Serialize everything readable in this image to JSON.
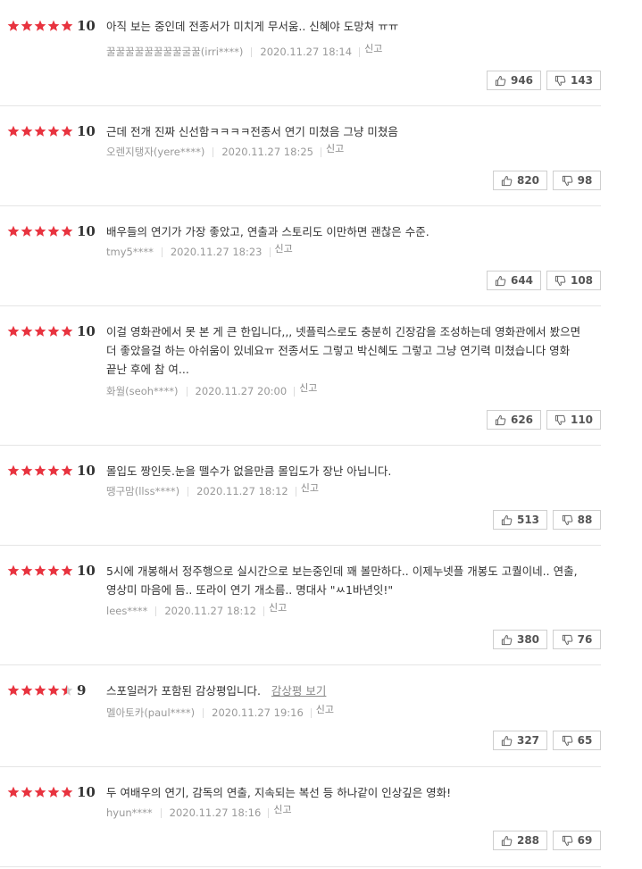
{
  "colors": {
    "star_fill": "#e8333f",
    "star_empty": "#cccccc"
  },
  "actions": {
    "report": "신고"
  },
  "reviews": [
    {
      "stars": 5,
      "half": false,
      "score": "10",
      "text": "아직 보는 중인데 전종서가 미치게 무서움.. 신혜야 도망쳐 ㅠㅠ",
      "user": "꿀꿀꿀꿀꿀꿀꿀꿀굴꿀(irri****)",
      "date": "2020.11.27 18:14",
      "likes": "946",
      "dislikes": "143"
    },
    {
      "stars": 5,
      "half": false,
      "score": "10",
      "text": "근데 전개 진짜 신선함ㅋㅋㅋㅋ전종서 연기 미쳤음 그냥 미쳤음",
      "user": "오렌지탱자(yere****)",
      "date": "2020.11.27 18:25",
      "likes": "820",
      "dislikes": "98"
    },
    {
      "stars": 5,
      "half": false,
      "score": "10",
      "text": "배우들의 연기가 가장 좋았고, 연출과 스토리도 이만하면 괜찮은 수준.",
      "user": "tmy5****",
      "date": "2020.11.27 18:23",
      "likes": "644",
      "dislikes": "108"
    },
    {
      "stars": 5,
      "half": false,
      "score": "10",
      "text": "이걸 영화관에서 못 본 게 큰 한입니다,,, 넷플릭스로도 충분히 긴장감을 조성하는데 영화관에서 봤으면 더 좋았을걸 하는 아쉬움이 있네요ㅠ 전종서도 그렇고 박신혜도 그렇고 그냥 연기력 미쳤습니다 영화 끝난 후에 참 여...",
      "user": "화월(seoh****)",
      "date": "2020.11.27 20:00",
      "likes": "626",
      "dislikes": "110"
    },
    {
      "stars": 5,
      "half": false,
      "score": "10",
      "text": "몰입도 짱인듯.눈을 뗄수가 없을만큼 몰입도가 장난 아닙니다.",
      "user": "땡구맘(llss****)",
      "date": "2020.11.27 18:12",
      "likes": "513",
      "dislikes": "88"
    },
    {
      "stars": 5,
      "half": false,
      "score": "10",
      "text": "5시에 개봉해서 정주행으로 실시간으로 보는중인데 꽤 볼만하다.. 이제누넷플 개봉도 고퀄이네.. 연출, 영상미 마음에 듬.. 또라이 연기 개소름.. 명대사 \"ㅆ1바년잇!\"",
      "user": "lees****",
      "date": "2020.11.27 18:12",
      "likes": "380",
      "dislikes": "76"
    },
    {
      "stars": 4,
      "half": true,
      "score": "9",
      "text": "스포일러가 포함된 감상평입니다.",
      "spoiler_link": "감상평 보기",
      "user": "멜아토카(paul****)",
      "date": "2020.11.27 19:16",
      "likes": "327",
      "dislikes": "65"
    },
    {
      "stars": 5,
      "half": false,
      "score": "10",
      "text": "두 여배우의 연기, 감독의 연출, 지속되는 복선 등 하나같이 인상깊은 영화!",
      "user": "hyun****",
      "date": "2020.11.27 18:16",
      "likes": "288",
      "dislikes": "69"
    }
  ]
}
